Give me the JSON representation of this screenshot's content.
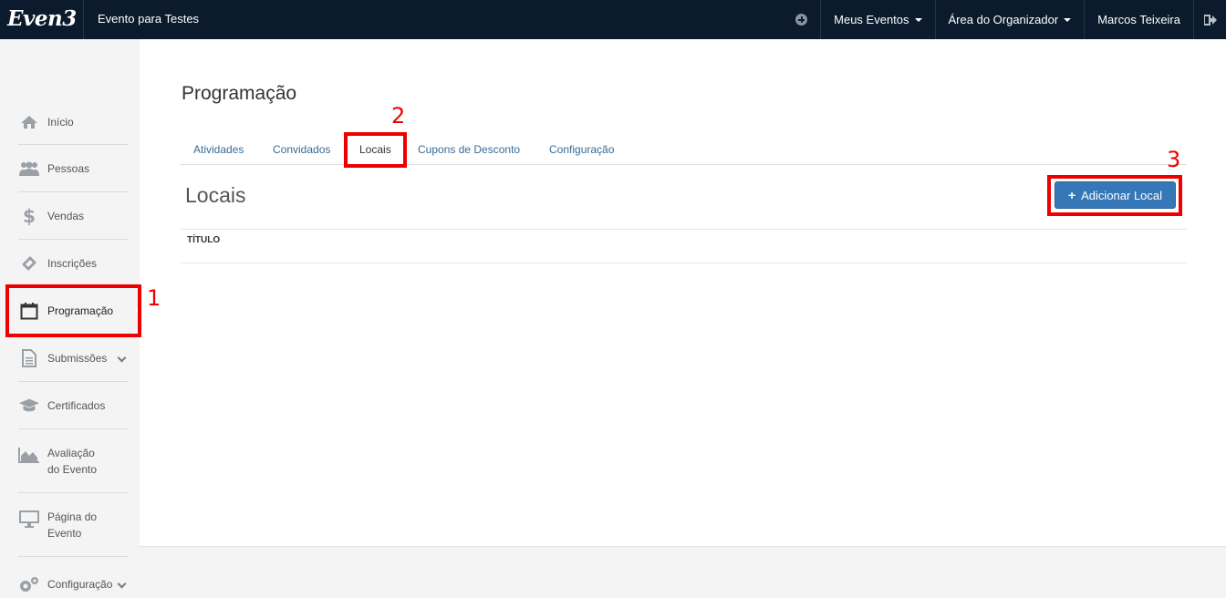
{
  "header": {
    "logo": "Even3",
    "event_name": "Evento para Testes",
    "menu": [
      {
        "label": "Meus Eventos",
        "icon": "caret-down-icon"
      },
      {
        "label": "Área do Organizador",
        "icon": "caret-down-icon"
      },
      {
        "label": "Marcos Teixeira"
      }
    ],
    "add_icon": "plus-circle-icon",
    "logout_icon": "sign-out-icon"
  },
  "sidebar": {
    "items": [
      {
        "label": "Início",
        "icon": "home-icon"
      },
      {
        "label": "Pessoas",
        "icon": "users-icon"
      },
      {
        "label": "Vendas",
        "icon": "dollar-icon"
      },
      {
        "label": "Inscrições",
        "icon": "ticket-icon"
      },
      {
        "label": "Programação",
        "icon": "calendar-icon",
        "active": true
      },
      {
        "label": "Submissões",
        "icon": "document-icon",
        "expandable": true
      },
      {
        "label": "Certificados",
        "icon": "graduation-cap-icon"
      },
      {
        "label": "Avaliação do Evento",
        "label_line1": "Avaliação",
        "label_line2": "do Evento",
        "icon": "area-chart-icon"
      },
      {
        "label": "Página do Evento",
        "label_line1": "Página do",
        "label_line2": "Evento",
        "icon": "monitor-icon"
      },
      {
        "label": "Configuração",
        "icon": "gears-icon",
        "expandable": true
      }
    ]
  },
  "main": {
    "page_title": "Programação",
    "tabs": [
      {
        "label": "Atividades"
      },
      {
        "label": "Convidados"
      },
      {
        "label": "Locais",
        "active": true
      },
      {
        "label": "Cupons de Desconto"
      },
      {
        "label": "Configuração"
      }
    ],
    "section_title": "Locais",
    "add_button": "Adicionar Local",
    "table": {
      "columns": [
        "TÍTULO"
      ],
      "rows": []
    }
  },
  "annotations": [
    "1",
    "2",
    "3"
  ],
  "colors": {
    "topbar": "#0b1a2c",
    "primary_button": "#3677b8",
    "link": "#3a6a96",
    "annotation": "#ee0000"
  }
}
